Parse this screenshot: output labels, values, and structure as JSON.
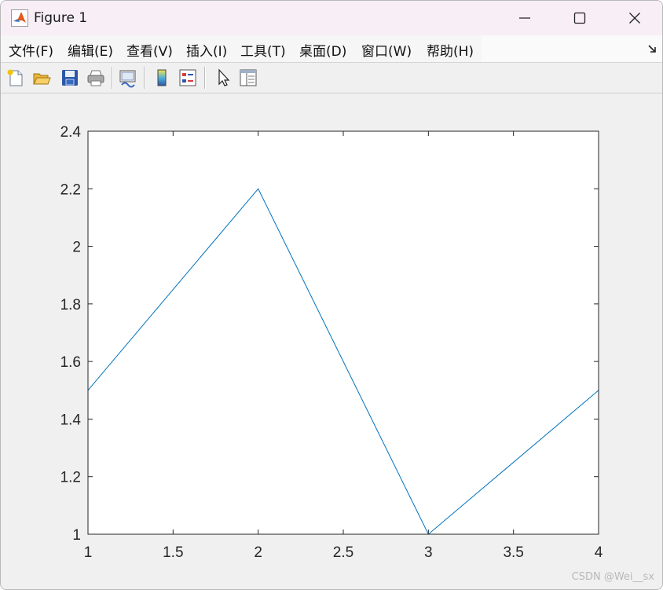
{
  "window": {
    "title": "Figure 1"
  },
  "menu": {
    "items": [
      "文件(F)",
      "编辑(E)",
      "查看(V)",
      "插入(I)",
      "工具(T)",
      "桌面(D)",
      "窗口(W)",
      "帮助(H)"
    ]
  },
  "toolbar": {
    "icons": [
      "new-figure-icon",
      "open-file-icon",
      "save-icon",
      "print-icon",
      "link-plot-icon",
      "colorbar-icon",
      "legend-icon",
      "pointer-icon",
      "property-inspector-icon"
    ]
  },
  "chart_data": {
    "type": "line",
    "x": [
      1,
      2,
      3,
      4
    ],
    "series": [
      {
        "values": [
          1.5,
          2.2,
          1.0,
          1.5
        ],
        "color": "#0072bd"
      }
    ],
    "xlim": [
      1,
      4
    ],
    "ylim": [
      1,
      2.4
    ],
    "xticks": [
      "1",
      "1.5",
      "2",
      "2.5",
      "3",
      "3.5",
      "4"
    ],
    "yticks": [
      "1",
      "1.2",
      "1.4",
      "1.6",
      "1.8",
      "2",
      "2.2",
      "2.4"
    ],
    "grid": false,
    "title": "",
    "xlabel": "",
    "ylabel": ""
  },
  "watermark": "CSDN @Wei__sx"
}
